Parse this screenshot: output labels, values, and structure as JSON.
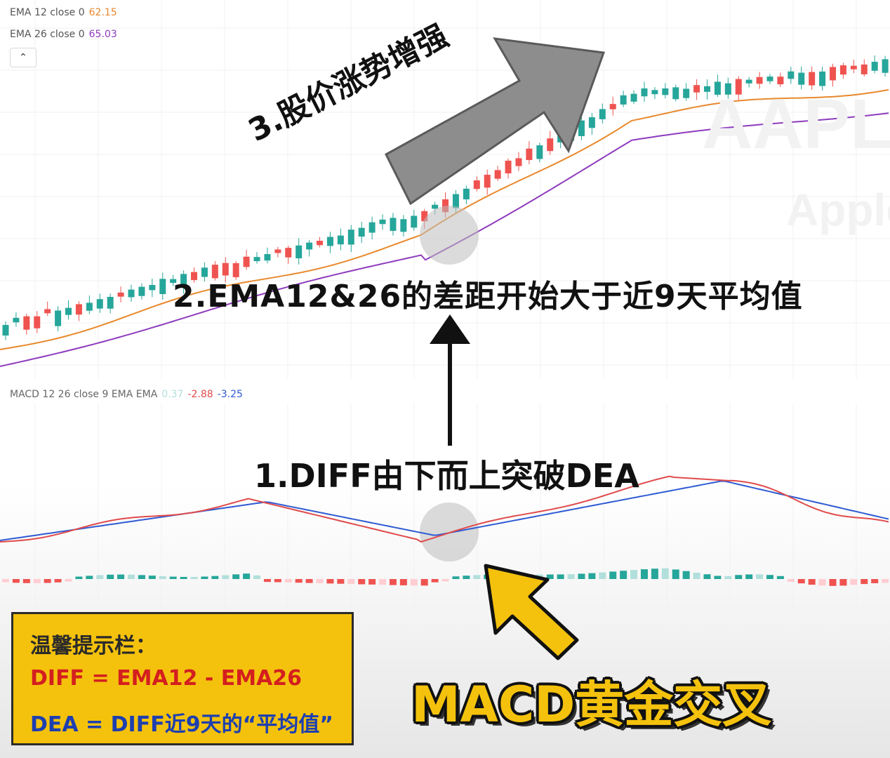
{
  "legend": {
    "ema12": {
      "label": "EMA 12 close 0",
      "value": "62.15",
      "color": "#e8892d"
    },
    "ema26": {
      "label": "EMA 26 close 0",
      "value": "65.03",
      "color": "#8e3bbd"
    },
    "collapse_icon": "chevron-up-icon"
  },
  "macd_legend": {
    "label": "MACD 12 26 close 9 EMA EMA",
    "hist": "0.37",
    "macd": "-2.88",
    "signal": "-3.25",
    "colors": {
      "hist": "#b2dfdb",
      "macd": "#e04b4b",
      "signal": "#2f5bd3"
    }
  },
  "watermark": {
    "ticker": "AAPL",
    "name": "Apple"
  },
  "annotations": {
    "step3": "3.股价涨势增强",
    "step2": "2.EMA12&26的差距开始大于近9天平均值",
    "step1": "1.DIFF由下而上突破DEA",
    "golden_cross": "MACD黄金交叉"
  },
  "tips": {
    "title": "温馨提示栏：",
    "line1": "DIFF = EMA12 - EMA26",
    "line2": "DEA = DIFF近9天的“平均值”"
  },
  "colors": {
    "up": "#26a69a",
    "down": "#ef5350",
    "tipbox": "#f4c20d"
  },
  "chart_data": [
    {
      "type": "candlestick",
      "series": [
        {
          "name": "EMA 12 close 0"
        },
        {
          "name": "EMA 26 close 0"
        }
      ]
    },
    {
      "type": "line",
      "series": [
        {
          "name": "MACD"
        },
        {
          "name": "Signal"
        },
        {
          "name": "Histogram"
        }
      ]
    }
  ]
}
